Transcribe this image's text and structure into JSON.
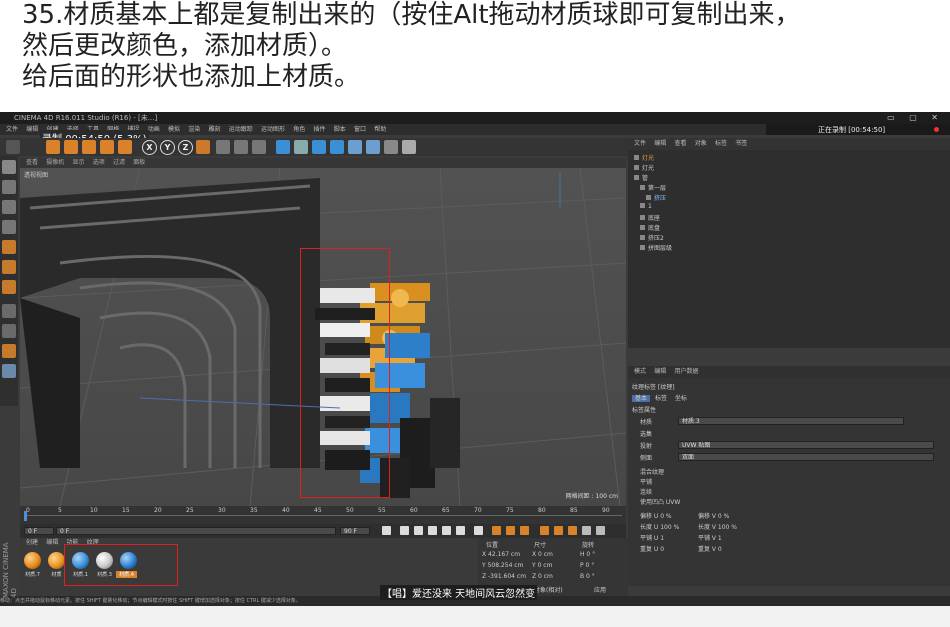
{
  "caption": {
    "line1": "35.材质基本上都是复制出来的（按住Alt拖动材质球即可复制出来，",
    "line2": "然后更改颜色，添加材质）。",
    "line3": "给后面的形状也添加上材质。"
  },
  "window": {
    "title": "CINEMA 4D R16.011 Studio (R16) - [未...]"
  },
  "recording": {
    "text": "正在录制 [00:54:50]",
    "timer": "00:54:50 (5.3%)",
    "timer_prefix": "录制"
  },
  "menu": [
    "文件",
    "编辑",
    "创建",
    "选择",
    "工具",
    "网格",
    "捕捉",
    "动画",
    "模拟",
    "渲染",
    "雕刻",
    "运动跟踪",
    "运动图形",
    "角色",
    "插件",
    "脚本",
    "窗口",
    "帮助"
  ],
  "viewport": {
    "label": "透视视图",
    "tabs": [
      "查看",
      "摄像机",
      "显示",
      "选项",
      "过滤",
      "面板"
    ],
    "grid_spacing": "网格间距 : 100 cm"
  },
  "object_manager": {
    "tabs": [
      "文件",
      "编辑",
      "查看",
      "对象",
      "标签",
      "书签"
    ],
    "objects": [
      "灯光",
      "灯光",
      "管",
      "第一层",
      "挤压",
      "1",
      "底座",
      "底盘",
      "挤压2",
      "拼图层级"
    ]
  },
  "attributes": {
    "tabs": [
      "模式",
      "编辑",
      "用户数据"
    ],
    "title": "纹理标签 [纹理]",
    "subtabs": [
      "基本",
      "标签",
      "坐标"
    ],
    "section": "标签属性",
    "material_label": "材质",
    "material_value": "材质.3",
    "selection_label": "选集",
    "projection_label": "投射",
    "projection_value": "UVW 贴图",
    "side_label": "侧面",
    "side_value": "双面",
    "mix_label": "混合纹理",
    "tile_label": "平铺",
    "seamless_label": "连续",
    "uvw_label": "使用凹凸 UVW",
    "offset_u": "偏移 U  0 %",
    "offset_v": "偏移 V  0 %",
    "length_u": "长度 U  100 %",
    "length_v": "长度 V  100 %",
    "tiles_u": "平铺 U  1",
    "tiles_v": "平铺 V  1",
    "repeat_u": "重复 U  0",
    "repeat_v": "重复 V  0"
  },
  "timeline": {
    "ticks": [
      "0",
      "5",
      "10",
      "15",
      "20",
      "25",
      "30",
      "35",
      "40",
      "45",
      "50",
      "55",
      "60",
      "65",
      "70",
      "75",
      "80",
      "85",
      "90"
    ],
    "frame_start": "0 F",
    "frame_end": "90 F",
    "current": "0 F"
  },
  "materials": {
    "tabs": [
      "创建",
      "编辑",
      "功能",
      "纹理"
    ],
    "items": [
      {
        "label": "材质.7",
        "color": "#e88a1c"
      },
      {
        "label": "材质",
        "color": "#e8931f"
      },
      {
        "label": "材质.1",
        "color": "#3b8fd6"
      },
      {
        "label": "材质.3",
        "color": "#c9c9c9"
      },
      {
        "label": "材质.4",
        "color": "#2f7fd0"
      }
    ]
  },
  "coordinates": {
    "headers": [
      "位置",
      "尺寸",
      "旋转"
    ],
    "x": "X  42.167 cm",
    "y": "Y  508.254 cm",
    "z": "Z  -391.604 cm",
    "sx": "X  0 cm",
    "sy": "Y  0 cm",
    "sz": "Z  0 cm",
    "h": "H  0 °",
    "p": "P  0 °",
    "b": "B  0 °",
    "mode": "对象(相对)",
    "apply": "应用"
  },
  "status": "移动：点击并拖动鼠标移动元素。按住 SHIFT 键量化移动；节点编辑模式时按住 SHIFT 键增加选择对象；按住 CTRL 键减少选择对象。",
  "subtitle": "【唱】爱还没来 天地间风云忽然变",
  "brand": "MAXON CINEMA 4D"
}
